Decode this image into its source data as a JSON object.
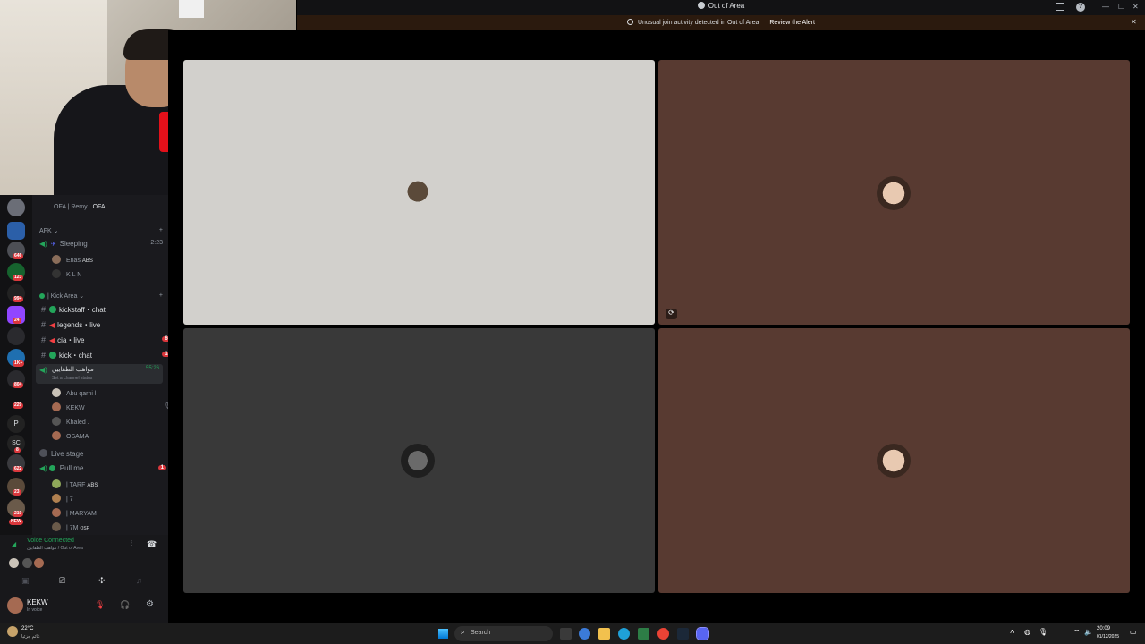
{
  "window": {
    "title": "Out of Area",
    "controls": [
      "—",
      "☐",
      "✕"
    ]
  },
  "alert": {
    "message": "Unusual join activity detected in Out of Area",
    "link": "Review the Alert",
    "close": "✕"
  },
  "servers": {
    "badges": [
      "646",
      "123",
      "99+",
      "24",
      "1K+",
      "804",
      "229",
      "8",
      "622",
      "23",
      "219",
      "NEW"
    ],
    "letters": [
      "P",
      "SC"
    ]
  },
  "channels": {
    "top_item": "OFA | Remy",
    "top_item_tag": "OFA",
    "afk_category": "AFK",
    "sleeping": {
      "name": "Sleeping",
      "time": "2:23"
    },
    "afk_users": [
      {
        "name": "Enas",
        "tag": "ABS"
      },
      {
        "name": "K L N",
        "tag": ""
      }
    ],
    "kick_category": "| Kick Area",
    "text_channels": [
      {
        "name": "kickstaff・chat",
        "count": ""
      },
      {
        "name": "legends・live",
        "count": ""
      },
      {
        "name": "cia・live",
        "count": "60"
      },
      {
        "name": "kick・chat",
        "count": "14"
      }
    ],
    "active_voice": {
      "name": "مواهب الطقايين",
      "time": "55:26",
      "status": "Set a channel status"
    },
    "voice_users": [
      "Abu qarni l",
      "KEKW",
      "Khaled .",
      "OSAMA"
    ],
    "live_stage": "Live stage",
    "pull_me": {
      "name": "Pull me",
      "count": "1"
    },
    "stage_users": [
      {
        "name": "| TARF",
        "tag": "ABS"
      },
      {
        "name": "| 7",
        "tag": ""
      },
      {
        "name": "| MARYAM",
        "tag": ""
      },
      {
        "name": "| 7M",
        "tag": "OSF"
      }
    ]
  },
  "voice": {
    "status": "Voice Connected",
    "location": "مواهب الطقايين / Out of Area"
  },
  "user": {
    "name": "KEKW",
    "status": "In voice"
  },
  "taskbar": {
    "weather_temp": "22°C",
    "weather_desc": "غائم جزئيا",
    "search": "Search",
    "time": "20:09",
    "date": "01/12/2025"
  },
  "colors": {
    "tile1": "#d2d0cc",
    "tile2": "#583a31",
    "tile3": "#393939",
    "tile4": "#583a31",
    "accent_green": "#23a55a",
    "badge_red": "#da373c"
  }
}
